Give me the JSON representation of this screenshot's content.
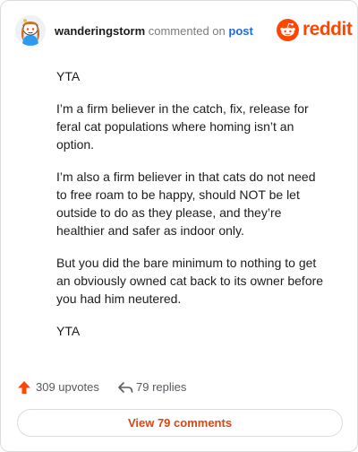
{
  "header": {
    "author": "wanderingstorm",
    "action": "commented on",
    "target": "post",
    "brand": "reddit",
    "avatar_icon": "snoo-avatar-icon",
    "brand_icon": "reddit-logo-icon"
  },
  "comment": {
    "paragraphs": [
      "YTA",
      "I’m a firm believer in the catch, fix, release for feral cat populations where homing isn’t an option.",
      "I’m also a firm believer in that cats do not need to free roam to be happy, should NOT be let outside to do as they please, and they’re healthier and safer as indoor only.",
      "But you did the bare minimum to nothing to get an obviously owned cat back to its owner before you had him neutered.",
      "YTA"
    ]
  },
  "stats": {
    "upvotes": "309 upvotes",
    "replies": "79 replies",
    "upvote_icon": "upvote-arrow-icon",
    "reply_icon": "reply-arrow-icon"
  },
  "actions": {
    "view_comments": "View 79 comments"
  },
  "colors": {
    "brand": "#ff4500",
    "link": "#1a6ce3",
    "button_text": "#d84614"
  }
}
